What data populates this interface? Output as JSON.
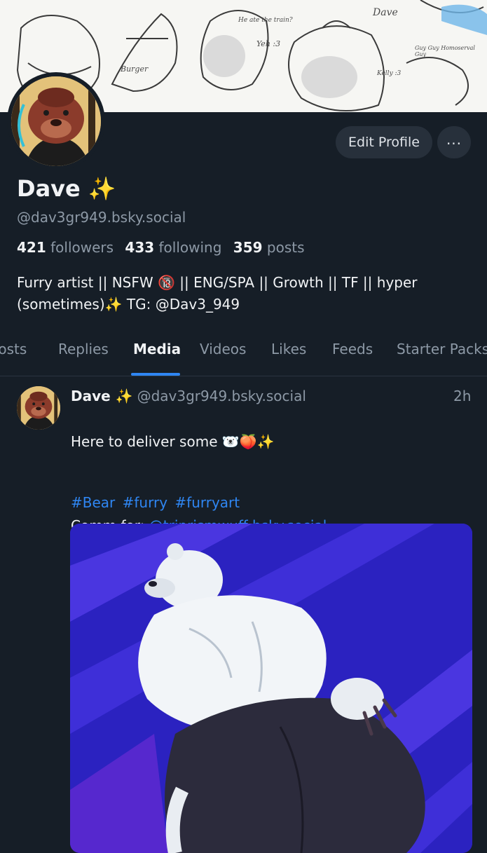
{
  "banner": {
    "labels": [
      "Burger",
      "Dave",
      "Yeh :3",
      "He ate the train?",
      "Guy Guy Homoserval Guy",
      "Kelly :3"
    ]
  },
  "profile": {
    "name": "Dave ✨",
    "handle": "@dav3gr949.bsky.social",
    "edit_label": "Edit Profile",
    "more_label": "...",
    "followers_count": "421",
    "followers_label": "followers",
    "following_count": "433",
    "following_label": "following",
    "posts_count": "359",
    "posts_label": "posts",
    "bio_line1": "Furry artist || NSFW 🔞 || ENG/SPA || Growth || TF || hyper",
    "bio_line2": "(sometimes)✨ TG: @Dav3_949"
  },
  "tabs": [
    {
      "label": "Posts"
    },
    {
      "label": "Replies"
    },
    {
      "label": "Media",
      "active": true
    },
    {
      "label": "Videos"
    },
    {
      "label": "Likes"
    },
    {
      "label": "Feeds"
    },
    {
      "label": "Starter Packs"
    }
  ],
  "post": {
    "author_name": "Dave ✨",
    "author_handle": "@dav3gr949.bsky.social",
    "time": "2h",
    "text_line1": "Here to deliver some 🐻‍❄️🍑✨",
    "comm_prefix": "Comm for: ",
    "comm_link": "@triprismwuff.bsky.social",
    "hashtags": [
      "#Bear",
      "#furry",
      "#furryart"
    ]
  },
  "colors": {
    "background": "#161e27",
    "accent": "#2f86f2",
    "muted_text": "#8d99a6",
    "button_bg": "#27303b"
  }
}
